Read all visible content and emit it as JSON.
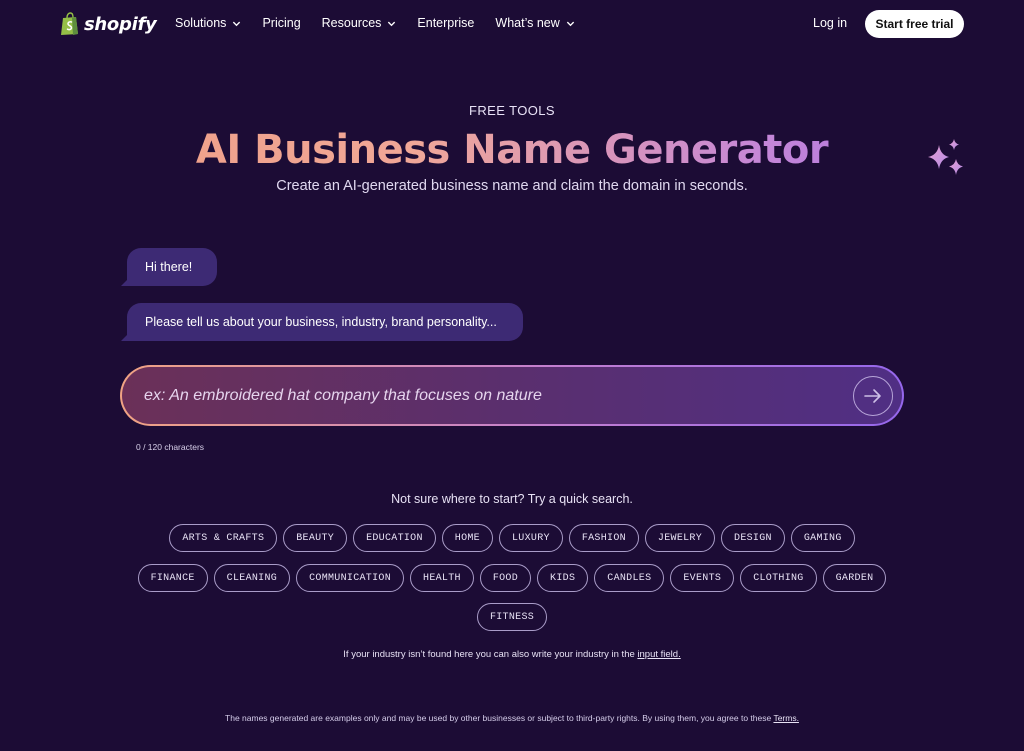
{
  "nav": {
    "logo_text": "shopify",
    "links": [
      {
        "label": "Solutions",
        "dropdown": true
      },
      {
        "label": "Pricing",
        "dropdown": false
      },
      {
        "label": "Resources",
        "dropdown": true
      },
      {
        "label": "Enterprise",
        "dropdown": false
      },
      {
        "label": "What’s new",
        "dropdown": true
      }
    ],
    "login": "Log in",
    "cta": "Start free trial"
  },
  "hero": {
    "eyebrow": "FREE TOOLS",
    "title": "AI Business Name Generator",
    "subtitle": "Create an AI-generated business name and claim the domain in seconds."
  },
  "chat": {
    "greeting": "Hi there!",
    "prompt": "Please tell us about your business, industry, brand personality..."
  },
  "input": {
    "placeholder": "ex: An embroidered hat company that focuses on nature",
    "value": "",
    "char_count": "0 / 120 characters"
  },
  "quick_search": {
    "title": "Not sure where to start? Try a quick search.",
    "rows": [
      [
        "ARTS & CRAFTS",
        "BEAUTY",
        "EDUCATION",
        "HOME",
        "LUXURY",
        "FASHION",
        "JEWELRY",
        "DESIGN",
        "GAMING"
      ],
      [
        "FINANCE",
        "CLEANING",
        "COMMUNICATION",
        "HEALTH",
        "FOOD",
        "KIDS",
        "CANDLES",
        "EVENTS",
        "CLOTHING",
        "GARDEN"
      ],
      [
        "FITNESS"
      ]
    ],
    "hint_prefix": "If your industry isn’t found here you can also write your industry in the",
    "hint_link": "input field."
  },
  "footer": {
    "text": "The names generated are examples only and may be used by other businesses or subject to third-party rights. By using them, you agree to these",
    "link": "Terms."
  },
  "colors": {
    "background": "#1c0c35",
    "bubble": "#3d2a74",
    "gradient_start": "#ee9d82",
    "gradient_end": "#a06be6",
    "logo_green": "#95bf47"
  }
}
